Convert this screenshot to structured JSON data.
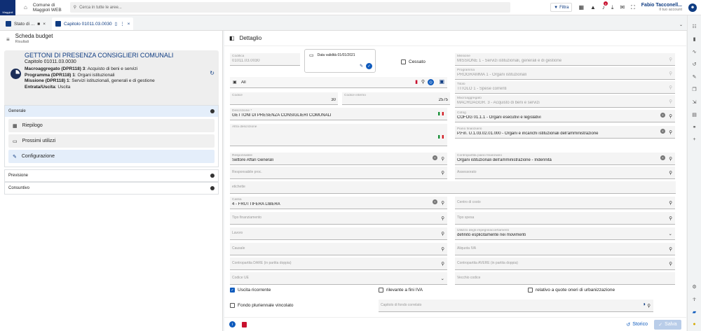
{
  "topbar": {
    "logo_text": "Maggioli",
    "org_line1": "Comune di",
    "org_line2": "Maggioli WEB",
    "search_placeholder": "Cerca in tutte le aree...",
    "filter_label": "Filtra",
    "notification_count": "9",
    "user_name": "Fabio Tacconell...",
    "user_sub": "Il tuo account"
  },
  "tabs": [
    {
      "label": "Stato di ..."
    },
    {
      "label": "Capitolo 01011.03.0030"
    }
  ],
  "left": {
    "header_title": "Scheda budget",
    "header_sub": "Risultati",
    "card": {
      "title": "GETTONI DI PRESENZA CONSIGLIERI COMUNALI",
      "capitolo": "Capitolo 01011.03.0030",
      "macro_label": "Macroaggregato (DPR118) 3",
      "macro_value": ": Acquisto di beni e servizi",
      "prog_label": "Programma (DPR118) 1",
      "prog_value": ": Organi istituzionali",
      "miss_label": "Missione (DPR118) 1",
      "miss_value": ": Servizi istituzionali, generali e di gestione",
      "ent_label": "Entrata/Uscita",
      "ent_value": ": Uscita"
    },
    "sections": {
      "generale": "Generale",
      "riepilogo": "Riepilogo",
      "prossimi": "Prossimi utilizzi",
      "configurazione": "Configurazione",
      "previsione": "Previsione",
      "consuntivo": "Consuntivo"
    }
  },
  "main": {
    "title": "Dettaglio",
    "codifica_label": "Codifica",
    "codifica_value": "01011.03.0030",
    "date_label": "Data validità 01/01/2021",
    "cessato_label": "Cessato",
    "all_value": "All",
    "missione_label": "Missione",
    "missione_value": "MISSIONE 1 - Servizi istituzionali, generali e di gestione",
    "programma_label": "Programma",
    "programma_value": "PROGRAMMA 1 - Organi istituzionali",
    "titolo_label": "Titolo",
    "titolo_value": "TITOLO 1 - Spese correnti",
    "macro_label": "Macroaggregato",
    "macro_value": "MACROAGGR. 3 - Acquisto di beni e servizi",
    "codice_label": "Codice",
    "codice_value": "30",
    "codice_interno_label": "Codice interno",
    "codice_interno_value": "2575",
    "descrizione_label": "Descrizione *",
    "descrizione_value": "GETTONI DI PRESENZA CONSIGLIERI COMUNALI",
    "cofog_label": "Cofog",
    "cofog_value": "COFOG 01.1.1 - Organi esecutivi e legislativi",
    "altra_label": "Altra descrizione",
    "piano_label": "Piano finanziario",
    "piano_value": "P.Fin. U.1.03.02.01.000 - Organi e incarichi istituzionali dell'amministrazione",
    "responsabile_label": "Responsabile",
    "responsabile_value": "Settore Affari Generali",
    "contropartita_label": "Contropartita piano finanziario",
    "contropartita_value": "Organi istituzionali dell'amministrazione - Indennità",
    "resp_proc_label": "Responsabile proc.",
    "assessorato_label": "Assessorato",
    "etichette_label": "etichette",
    "cassa_label": "Cassa",
    "cassa_value": "4 - FRUTTIFERA LIBERA",
    "centro_costo_label": "Centro di costo",
    "tipo_fin_label": "Tipo finanziamento",
    "tipo_spesa_label": "Tipo spesa",
    "lavoro_label": "Lavoro",
    "utilizzo_label": "Utilizzo degli impegni/accertamenti",
    "utilizzo_value": "definito esplicitamente nei movimenti",
    "causale_label": "Causale",
    "aliquota_label": "Aliquota IVA",
    "dare_label": "Contropartita DARE (in partita doppia)",
    "avere_label": "Contropartita AVERE (in partita doppia)",
    "codice_ue_label": "Codice UE",
    "vecchio_label": "Vecchio codice",
    "uscita_ric": "Uscita ricorrente",
    "rilevante_iva": "rilevante a fini IVA",
    "oneri_urb": "relativo a quote oneri di urbanizzazione",
    "fondo_plur": "Fondo pluriennale vincolato",
    "capitolo_fondo_label": "Capitolo di fondo correlato",
    "storico_label": "Storico",
    "salva_label": "Salva"
  }
}
